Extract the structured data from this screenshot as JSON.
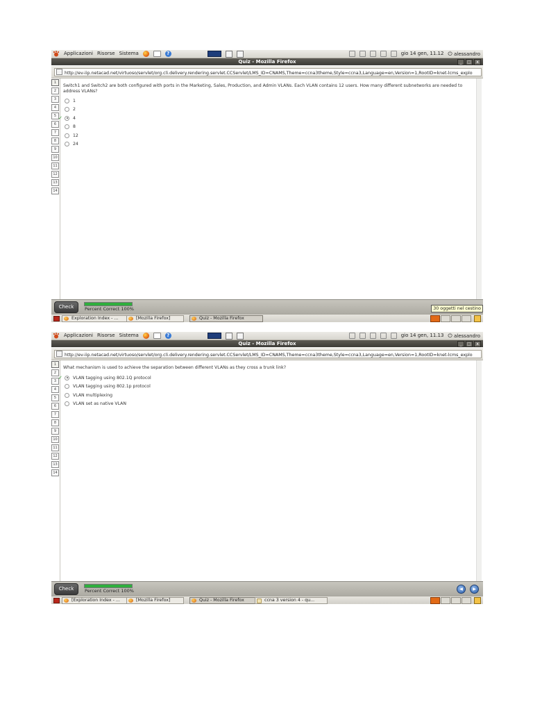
{
  "screenshots": [
    {
      "panel": {
        "apps_label": "Applicazioni",
        "places_label": "Risorse",
        "system_label": "Sistema",
        "clock": "gio 14 gen, 11.12",
        "user": "alessandro"
      },
      "window_title": "Quiz - Mozilla Firefox",
      "url": "http://ev-iip.netacad.net/virtuoso/servlet/org.cli.delivery.rendering.servlet.CCServlet/LMS_ID=CNAMS,Theme=ccna3theme,Style=ccna3,Language=en,Version=1,RootID=knet-lcms_explo",
      "question_numbers": [
        "1",
        "2",
        "3",
        "4",
        "5",
        "6",
        "7",
        "8",
        "9",
        "10",
        "11",
        "12",
        "13",
        "14"
      ],
      "question": "Switch1 and Switch2 are both configured with ports in the Marketing, Sales, Production, and Admin VLANs. Each VLAN contains 12 users. How many different subnetworks are needed to address VLANs?",
      "options": [
        "1",
        "2",
        "4",
        "8",
        "12",
        "24"
      ],
      "selected_index": 2,
      "check_label": "Check",
      "percent_label": "Percent Correct",
      "percent_value": "100%",
      "progress_fraction": 1.0,
      "tooltip": "30 oggetti nel cestino",
      "taskbar": [
        "Exploration Index - ...",
        "[Mozilla Firefox]",
        "Quiz - Mozilla Firefox"
      ]
    },
    {
      "panel": {
        "apps_label": "Applicazioni",
        "places_label": "Risorse",
        "system_label": "Sistema",
        "clock": "gio 14 gen, 11.13",
        "user": "alessandro"
      },
      "window_title": "Quiz - Mozilla Firefox",
      "url": "http://ev-iip.netacad.net/virtuoso/servlet/org.cli.delivery.rendering.servlet.CCServlet/LMS_ID=CNAMS,Theme=ccna3theme,Style=ccna3,Language=en,Version=1,RootID=knet-lcms_explo",
      "question_numbers": [
        "1",
        "2",
        "3",
        "4",
        "5",
        "6",
        "7",
        "8",
        "9",
        "10",
        "11",
        "12",
        "13",
        "14"
      ],
      "question": "What mechanism is used to achieve the separation between different VLANs as they cross a trunk link?",
      "options": [
        "VLAN tagging using 802.1Q protocol",
        "VLAN tagging using 802.1p protocol",
        "VLAN multiplexing",
        "VLAN set as native VLAN"
      ],
      "selected_index": 0,
      "check_label": "Check",
      "percent_label": "Percent Correct",
      "percent_value": "100%",
      "progress_fraction": 1.0,
      "taskbar": [
        "[Exploration Index - ...",
        "[Mozilla Firefox]",
        "Quiz - Mozilla Firefox",
        "ccna 3 version 4 - qu..."
      ]
    }
  ]
}
